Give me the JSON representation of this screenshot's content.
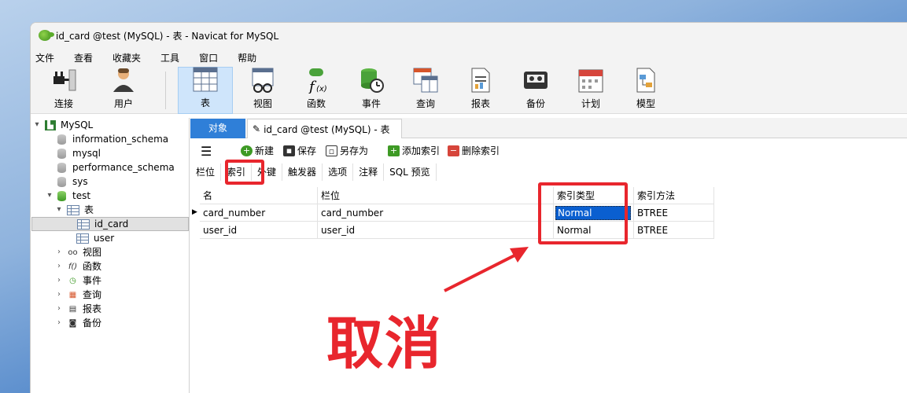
{
  "window": {
    "title": "id_card @test (MySQL) - 表 - Navicat for MySQL"
  },
  "menu": [
    "文件",
    "查看",
    "收藏夹",
    "工具",
    "窗口",
    "帮助"
  ],
  "toolbar": {
    "connect": "连接",
    "user": "用户",
    "table": "表",
    "view": "视图",
    "function": "函数",
    "event": "事件",
    "query": "查询",
    "report": "报表",
    "backup": "备份",
    "schedule": "计划",
    "model": "模型"
  },
  "tree": {
    "root": "MySQL",
    "dbs": [
      "information_schema",
      "mysql",
      "performance_schema",
      "sys"
    ],
    "test": "test",
    "tables_node": "表",
    "tables": [
      "id_card",
      "user"
    ],
    "others": [
      "视图",
      "函数",
      "事件",
      "查询",
      "报表",
      "备份"
    ]
  },
  "tabs": {
    "objects": "对象",
    "doc": "id_card @test (MySQL) - 表"
  },
  "actions": {
    "new": "新建",
    "save": "保存",
    "save_as": "另存为",
    "add_index": "添加索引",
    "delete_index": "删除索引"
  },
  "subtabs": [
    "栏位",
    "索引",
    "外键",
    "触发器",
    "选项",
    "注释",
    "SQL 预览"
  ],
  "table": {
    "headers": [
      "名",
      "栏位",
      "索引类型",
      "索引方法"
    ],
    "rows": [
      [
        "card_number",
        "card_number",
        "Normal",
        "BTREE"
      ],
      [
        "user_id",
        "user_id",
        "Normal",
        "BTREE"
      ]
    ]
  },
  "annotation": "取消",
  "colors": {
    "accent": "#2f7fd8",
    "annotation": "#e8262d",
    "selection": "#0a5fd0"
  }
}
